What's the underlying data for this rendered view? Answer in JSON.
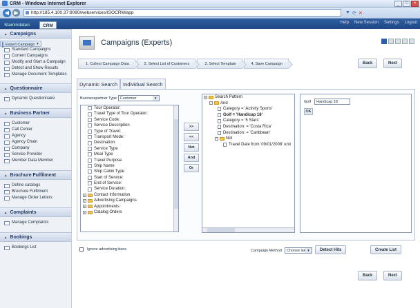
{
  "window": {
    "title": "CRM - Windows Internet Explorer"
  },
  "browser": {
    "url": "http://185.4.100.37:8080/webservices/ISOCRM/app"
  },
  "app": {
    "tabs": [
      "Stammdaten",
      "CRM"
    ],
    "top_links": [
      "Help",
      "New Session",
      "Settings",
      "Logout"
    ]
  },
  "sidebar": {
    "sections": [
      {
        "title": "Campaigns",
        "items": [
          "Expert Campaigns",
          "Standard Campaigns",
          "Current Campaigns",
          "Modify and Start a Campaign",
          "Detect and Show Results",
          "Manage Document Templates"
        ]
      },
      {
        "title": "Questionnaire",
        "items": [
          "Dynamic Questionnaire"
        ]
      },
      {
        "title": "Business Partner",
        "items": [
          "Customer",
          "Call Center",
          "Agency",
          "Agency Chain",
          "Company",
          "Service Provider",
          "Member Data Member"
        ]
      },
      {
        "title": "Brochure Fulfilment",
        "items": [
          "Define catalogs",
          "Brochure Fulfilment",
          "Manage Order Letters"
        ]
      },
      {
        "title": "Complaints",
        "items": [
          "Manage Complaints"
        ]
      },
      {
        "title": "Bookings",
        "items": [
          "Bookings List"
        ]
      }
    ]
  },
  "main": {
    "title": "Campaigns (Experts)",
    "steps": [
      "1. Collect Campaign Data",
      "2. Select List of Customers",
      "3. Select Template",
      "4. Save Campaign"
    ],
    "back_label": "Back",
    "next_label": "Next",
    "search_tabs": [
      "Dynamic Search",
      "Individual Search"
    ],
    "bp_type_label": "Businesspartner Type",
    "bp_type_value": "Customer",
    "attributes": [
      "Tour Operator:",
      "Travel Type of Tour Operator:",
      "Service Code:",
      "Service Description",
      "Type of Travel:",
      "Transport Mode:",
      "Destination:",
      "Service Type",
      "Meal Type",
      "Travel Purpose",
      "Ship Name",
      "Ship Cabin Type",
      "Start of Service:",
      "End of Service:",
      "Service Duration:"
    ],
    "folders": [
      "Contact Information",
      "Advertising Campaigns",
      "Appointments",
      "Catalog Orders"
    ],
    "mid_buttons": [
      ">>",
      "<<",
      "Not",
      "And",
      "Or"
    ],
    "pattern": {
      "root": "Search Pattern",
      "and": "And",
      "conditions": [
        "Category = 'Activity Sports'",
        "Golf = 'Handicap 18'",
        "Category = '5 Stars'",
        "Destination: = 'Costa Rica'",
        "Destination: = 'Caribbean'"
      ],
      "not": "Not",
      "not_condition": "Travel Date from '09/01/2008' unti"
    },
    "edit": {
      "label": "Golf",
      "value": "Handicap 18",
      "ok_label": "OK"
    },
    "ignore_label": "Ignore advertising bans",
    "method_label": "Campaign Method",
    "method_value": "Choose later",
    "detect_label": "Detect Hits",
    "create_label": "Create List"
  }
}
